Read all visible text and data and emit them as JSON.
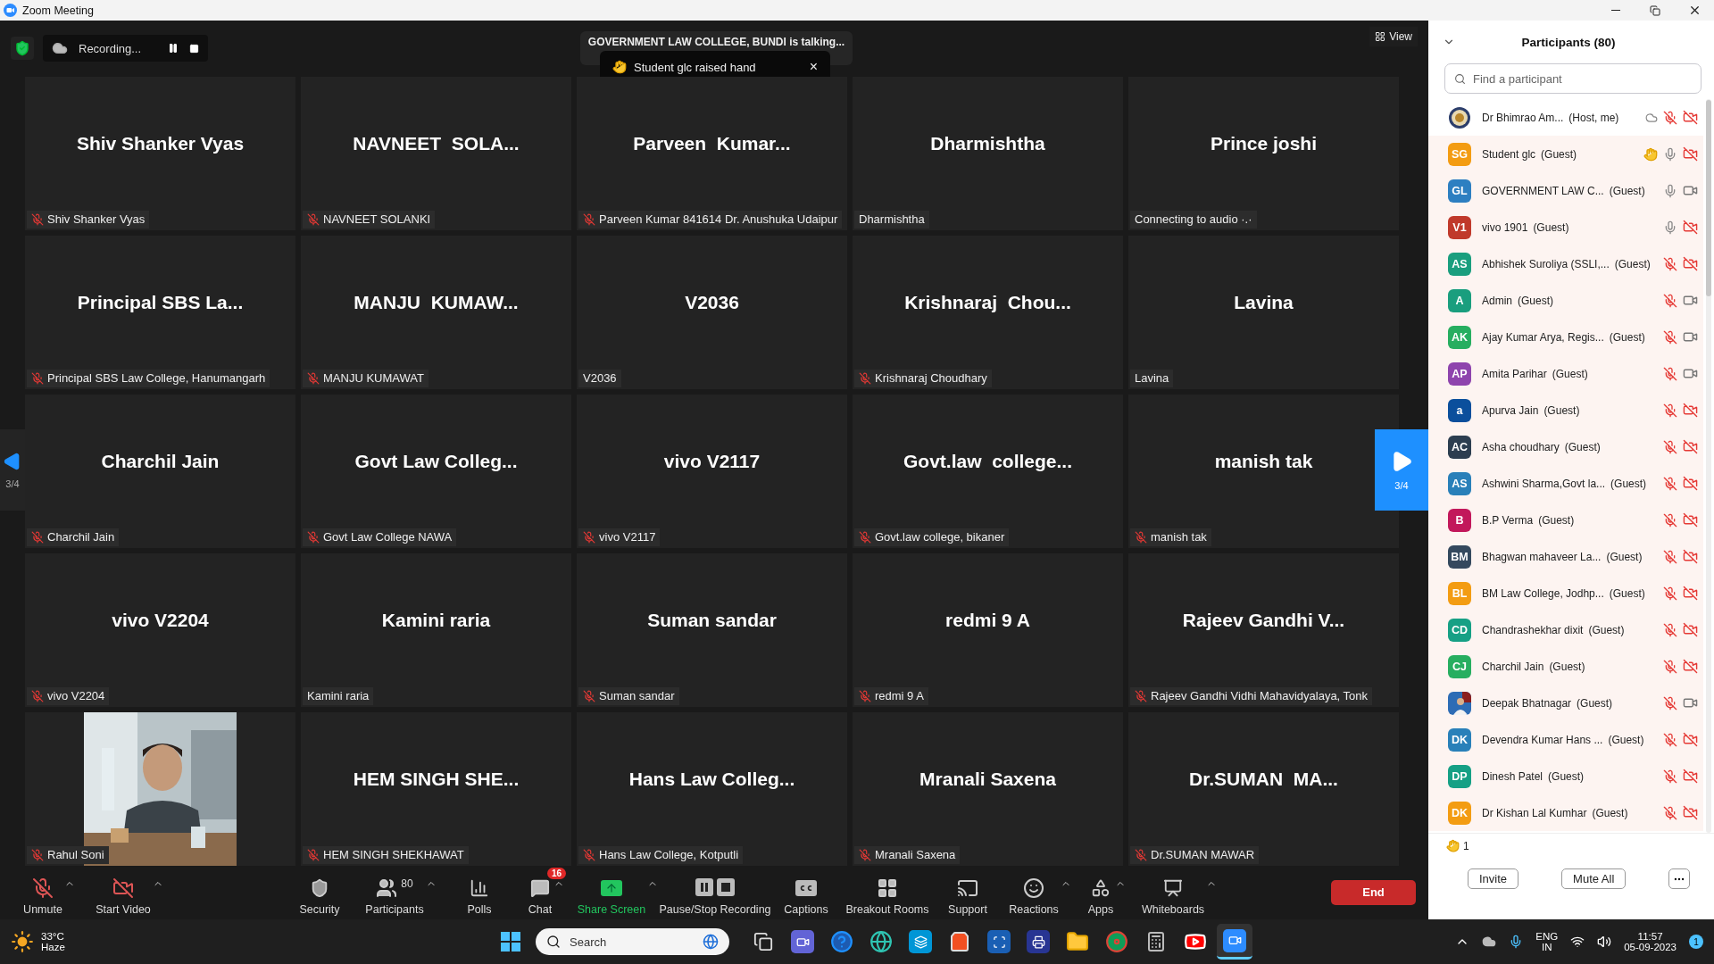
{
  "window": {
    "title": "Zoom Meeting"
  },
  "top_bar": {
    "recording_label": "Recording...",
    "talking_banner": "GOVERNMENT LAW COLLEGE, BUNDI is talking...",
    "toast": {
      "text": "Student glc raised hand",
      "close": "×"
    },
    "view_label": "View"
  },
  "pager": {
    "left": "3/4",
    "right": "3/4"
  },
  "tiles": [
    {
      "kind": "name",
      "name": "Shiv Shanker Vyas",
      "label": "Shiv Shanker Vyas",
      "muted": true
    },
    {
      "kind": "name",
      "name": "NAVNEET  SOLA...",
      "label": "NAVNEET SOLANKI",
      "muted": true
    },
    {
      "kind": "name",
      "name": "Parveen  Kumar...",
      "label": "Parveen Kumar 841614 Dr. Anushuka Udaipur",
      "muted": true
    },
    {
      "kind": "name",
      "name": "Dharmishtha",
      "label": "Dharmishtha",
      "muted": false
    },
    {
      "kind": "name",
      "name": "Prince joshi",
      "label": "Connecting to audio ·.·",
      "muted": false
    },
    {
      "kind": "name",
      "name": "Principal SBS La...",
      "label": "Principal SBS Law College, Hanumangarh",
      "muted": true
    },
    {
      "kind": "name",
      "name": "MANJU  KUMAW...",
      "label": "MANJU KUMAWAT",
      "muted": true
    },
    {
      "kind": "name",
      "name": "V2036",
      "label": "V2036",
      "muted": false
    },
    {
      "kind": "name",
      "name": "Krishnaraj  Chou...",
      "label": "Krishnaraj Choudhary",
      "muted": true
    },
    {
      "kind": "name",
      "name": "Lavina",
      "label": "Lavina",
      "muted": false
    },
    {
      "kind": "name",
      "name": "Charchil Jain",
      "label": "Charchil Jain",
      "muted": true
    },
    {
      "kind": "name",
      "name": "Govt Law Colleg...",
      "label": "Govt Law College NAWA",
      "muted": true
    },
    {
      "kind": "name",
      "name": "vivo V2117",
      "label": "vivo V2117",
      "muted": true
    },
    {
      "kind": "name",
      "name": "Govt.law  college...",
      "label": "Govt.law college, bikaner",
      "muted": true
    },
    {
      "kind": "name",
      "name": "manish tak",
      "label": "manish tak",
      "muted": true
    },
    {
      "kind": "name",
      "name": "vivo V2204",
      "label": "vivo V2204",
      "muted": true
    },
    {
      "kind": "name",
      "name": "Kamini raria",
      "label": "Kamini raria",
      "muted": false
    },
    {
      "kind": "name",
      "name": "Suman sandar",
      "label": "Suman sandar",
      "muted": true
    },
    {
      "kind": "name",
      "name": "redmi 9 A",
      "label": "redmi 9 A",
      "muted": true
    },
    {
      "kind": "name",
      "name": "Rajeev Gandhi V...",
      "label": "Rajeev Gandhi Vidhi Mahavidyalaya, Tonk",
      "muted": true
    },
    {
      "kind": "video",
      "label": "Rahul Soni",
      "muted": true
    },
    {
      "kind": "name",
      "name": "HEM SINGH SHE...",
      "label": "HEM SINGH SHEKHAWAT",
      "muted": true
    },
    {
      "kind": "name",
      "name": "Hans Law Colleg...",
      "label": "Hans Law College, Kotputli",
      "muted": true
    },
    {
      "kind": "name",
      "name": "Mranali Saxena",
      "label": "Mranali Saxena",
      "muted": true
    },
    {
      "kind": "name",
      "name": "Dr.SUMAN  MA...",
      "label": "Dr.SUMAN MAWAR",
      "muted": true
    }
  ],
  "participants": {
    "title": "Participants (80)",
    "search": {
      "placeholder": "Find a participant"
    },
    "rows": [
      {
        "kind": "emblem",
        "name": "Dr Bhimrao Am...",
        "role": "(Host, me)",
        "recording": true,
        "hand": false,
        "muted": true,
        "video_on": false,
        "highlighted": false
      },
      {
        "kind": "initials",
        "initials": "SG",
        "color": "#f39c12",
        "name": "Student glc",
        "role": "(Guest)",
        "recording": false,
        "hand": true,
        "muted": false,
        "video_on": false,
        "highlighted": true
      },
      {
        "kind": "initials",
        "initials": "GL",
        "color": "#2d7fc1",
        "name": "GOVERNMENT LAW C...",
        "role": "(Guest)",
        "recording": false,
        "hand": false,
        "muted": false,
        "video_on": true,
        "highlighted": true
      },
      {
        "kind": "initials",
        "initials": "V1",
        "color": "#c0392b",
        "name": "vivo 1901",
        "role": "(Guest)",
        "recording": false,
        "hand": false,
        "muted": false,
        "video_on": false,
        "highlighted": true
      },
      {
        "kind": "initials",
        "initials": "AS",
        "color": "#1a9e7e",
        "name": "Abhishek Suroliya (SSLI,...",
        "role": "(Guest)",
        "recording": false,
        "hand": false,
        "muted": true,
        "video_on": false,
        "highlighted": true
      },
      {
        "kind": "initials",
        "initials": "A",
        "color": "#1a9e7e",
        "name": "Admin",
        "role": "(Guest)",
        "recording": false,
        "hand": false,
        "muted": true,
        "video_on": true,
        "highlighted": true
      },
      {
        "kind": "initials",
        "initials": "AK",
        "color": "#27ae60",
        "name": "Ajay Kumar Arya, Regis...",
        "role": "(Guest)",
        "recording": false,
        "hand": false,
        "muted": true,
        "video_on": true,
        "highlighted": true
      },
      {
        "kind": "initials",
        "initials": "AP",
        "color": "#8e44ad",
        "name": "Amita Parihar",
        "role": "(Guest)",
        "recording": false,
        "hand": false,
        "muted": true,
        "video_on": true,
        "highlighted": true
      },
      {
        "kind": "initials",
        "initials": "a",
        "color": "#0b4f9c",
        "name": "Apurva Jain",
        "role": "(Guest)",
        "recording": false,
        "hand": false,
        "muted": true,
        "video_on": false,
        "highlighted": true
      },
      {
        "kind": "initials",
        "initials": "AC",
        "color": "#2c3e50",
        "name": "Asha choudhary",
        "role": "(Guest)",
        "recording": false,
        "hand": false,
        "muted": true,
        "video_on": false,
        "highlighted": true
      },
      {
        "kind": "initials",
        "initials": "AS",
        "color": "#2980b9",
        "name": "Ashwini Sharma,Govt la...",
        "role": "(Guest)",
        "recording": false,
        "hand": false,
        "muted": true,
        "video_on": false,
        "highlighted": true
      },
      {
        "kind": "initials",
        "initials": "B",
        "color": "#c2185b",
        "name": "B.P Verma",
        "role": "(Guest)",
        "recording": false,
        "hand": false,
        "muted": true,
        "video_on": false,
        "highlighted": true
      },
      {
        "kind": "initials",
        "initials": "BM",
        "color": "#34495e",
        "name": "Bhagwan mahaveer La...",
        "role": "(Guest)",
        "recording": false,
        "hand": false,
        "muted": true,
        "video_on": false,
        "highlighted": true
      },
      {
        "kind": "initials",
        "initials": "BL",
        "color": "#f39c12",
        "name": "BM Law College, Jodhp...",
        "role": "(Guest)",
        "recording": false,
        "hand": false,
        "muted": true,
        "video_on": false,
        "highlighted": true
      },
      {
        "kind": "initials",
        "initials": "CD",
        "color": "#16a085",
        "name": "Chandrashekhar dixit",
        "role": "(Guest)",
        "recording": false,
        "hand": false,
        "muted": true,
        "video_on": false,
        "highlighted": true
      },
      {
        "kind": "initials",
        "initials": "CJ",
        "color": "#27ae60",
        "name": "Charchil Jain",
        "role": "(Guest)",
        "recording": false,
        "hand": false,
        "muted": true,
        "video_on": false,
        "highlighted": true
      },
      {
        "name": "Deepak Bhatnagar",
        "role": "(Guest)",
        "recording": false,
        "hand": false,
        "muted": true,
        "video_on": true,
        "highlighted": true
      },
      {
        "kind": "initials",
        "initials": "DK",
        "color": "#2980b9",
        "name": "Devendra Kumar Hans ...",
        "role": "(Guest)",
        "recording": false,
        "hand": false,
        "muted": true,
        "video_on": false,
        "highlighted": true
      },
      {
        "kind": "initials",
        "initials": "DP",
        "color": "#16a085",
        "name": "Dinesh Patel",
        "role": "(Guest)",
        "recording": false,
        "hand": false,
        "muted": true,
        "video_on": false,
        "highlighted": true
      },
      {
        "kind": "initials",
        "initials": "DK",
        "color": "#f39c12",
        "name": "Dr Kishan Lal Kumhar",
        "role": "(Guest)",
        "recording": false,
        "hand": false,
        "muted": true,
        "video_on": false,
        "highlighted": true
      }
    ],
    "raised_count": "1",
    "buttons": [
      "Invite",
      "Mute All"
    ]
  },
  "toolbar": {
    "items": [
      {
        "kind": "mic",
        "label": "Unmute",
        "caret": true
      },
      {
        "kind": "camera",
        "label": "Start Video",
        "caret": true
      },
      {
        "kind": "security",
        "label": "Security",
        "caret": false
      },
      {
        "kind": "participants",
        "label": "Participants",
        "count": "80",
        "caret": true
      },
      {
        "kind": "polls",
        "label": "Polls",
        "caret": false
      },
      {
        "kind": "chat",
        "label": "Chat",
        "badge": "16",
        "caret": true
      },
      {
        "kind": "share",
        "label": "Share Screen",
        "caret": true
      },
      {
        "kind": "recording",
        "label": "Pause/Stop Recording",
        "caret": false
      },
      {
        "kind": "captions",
        "label": "Captions",
        "caret": false
      },
      {
        "kind": "breakout",
        "label": "Breakout Rooms",
        "caret": false
      },
      {
        "kind": "support",
        "label": "Support",
        "caret": false
      },
      {
        "kind": "reactions",
        "label": "Reactions",
        "caret": true
      },
      {
        "kind": "apps",
        "label": "Apps",
        "caret": true
      },
      {
        "kind": "whiteboards",
        "label": "Whiteboards",
        "caret": true
      }
    ],
    "end": "End"
  },
  "taskbar": {
    "temperature": "33°C",
    "weather": "Haze",
    "search_placeholder": "Search",
    "apps": [
      {
        "kind": "task-view",
        "selected": false
      },
      {
        "kind": "teams",
        "selected": false
      },
      {
        "kind": "help",
        "selected": false
      },
      {
        "kind": "edge",
        "selected": false
      },
      {
        "kind": "hp",
        "selected": false
      },
      {
        "kind": "store",
        "selected": false
      },
      {
        "kind": "scanner",
        "selected": false
      },
      {
        "kind": "scan",
        "selected": false
      },
      {
        "kind": "explorer",
        "selected": false
      },
      {
        "kind": "chrome",
        "selected": false
      },
      {
        "kind": "calculator",
        "selected": false
      },
      {
        "kind": "youtube",
        "selected": false
      },
      {
        "kind": "zoom",
        "selected": true
      }
    ],
    "language": "ENG",
    "region": "IN",
    "time": "11:57",
    "date": "05-09-2023",
    "notifications": "1"
  }
}
